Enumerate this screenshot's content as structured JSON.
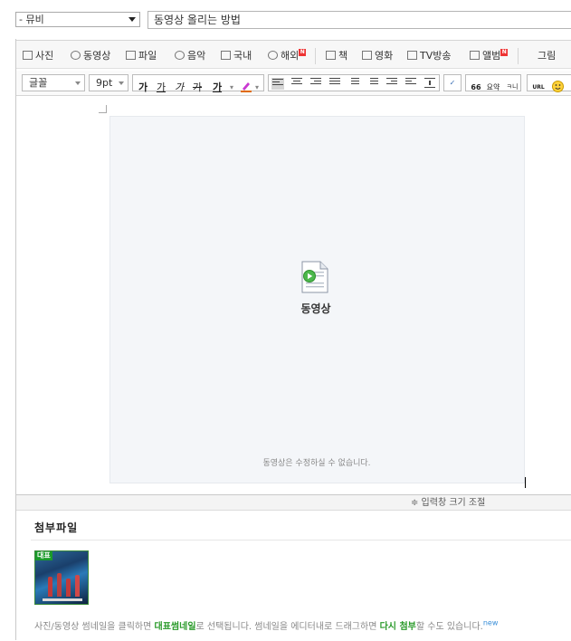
{
  "form": {
    "category": "- 뮤비",
    "title": "동영상 올리는 방법"
  },
  "toolbar1": {
    "items": [
      {
        "label": "사진",
        "icon": "camera-icon"
      },
      {
        "label": "동영상",
        "icon": "play-circle-icon"
      },
      {
        "label": "파일",
        "icon": "file-icon"
      },
      {
        "label": "음악",
        "icon": "music-icon"
      },
      {
        "label": "국내",
        "icon": "map-icon"
      },
      {
        "label": "해외",
        "icon": "globe-icon",
        "badge": "N"
      },
      {
        "label": "책",
        "icon": "book-icon"
      },
      {
        "label": "영화",
        "icon": "film-icon"
      },
      {
        "label": "TV방송",
        "icon": "tv-icon"
      },
      {
        "label": "앨범",
        "icon": "album-icon",
        "badge": "N"
      },
      {
        "label": "그림",
        "icon": "picture-icon"
      }
    ]
  },
  "toolbar2": {
    "font": "글꼴",
    "size": "9pt",
    "style_buttons": [
      "가",
      "가",
      "가",
      "가",
      "가"
    ],
    "quote_label": "66",
    "summary_label": "요약",
    "new_label": "ㅋ니",
    "url_label": "URL"
  },
  "content": {
    "video_label": "동영상",
    "no_edit_text": "동영상은 수정하실 수 없습니다."
  },
  "resize": {
    "label": "≑ 입력창 크기 조절"
  },
  "attach": {
    "title": "첨부파일",
    "rep_badge": "대표",
    "help_prefix": "사진/동영상 썸네일을 클릭하면 ",
    "help_highlight1": "대표썸네일",
    "help_middle": "로 선택됩니다. 썸네일을 에디터내로 드래그하면 ",
    "help_highlight2": "다시 첨부",
    "help_suffix": "할 수도 있습니다.",
    "new_badge": "new"
  }
}
